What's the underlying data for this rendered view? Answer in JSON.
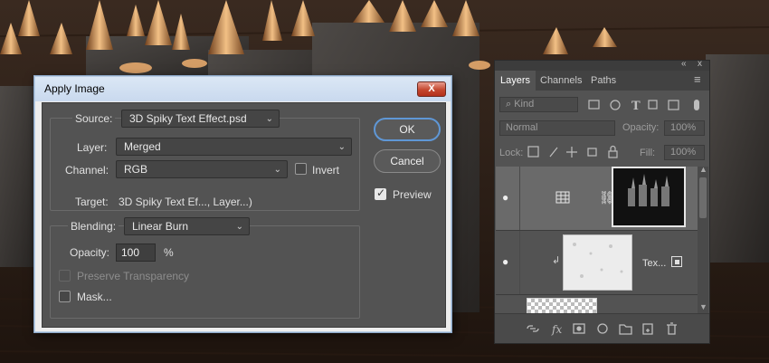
{
  "dialog": {
    "title": "Apply Image",
    "close_label": "X",
    "source_label": "Source:",
    "source_value": "3D Spiky Text Effect.psd",
    "layer_label": "Layer:",
    "layer_value": "Merged",
    "channel_label": "Channel:",
    "channel_value": "RGB",
    "invert_label": "Invert",
    "invert_checked": false,
    "target_label": "Target:",
    "target_value": "3D Spiky Text Ef..., Layer...)",
    "blending_label": "Blending:",
    "blending_value": "Linear Burn",
    "opacity_label": "Opacity:",
    "opacity_value": "100",
    "opacity_unit": "%",
    "preserve_label": "Preserve Transparency",
    "mask_label": "Mask...",
    "ok_label": "OK",
    "cancel_label": "Cancel",
    "preview_label": "Preview",
    "preview_checked": true
  },
  "panel": {
    "collapse_glyph": "«",
    "close_glyph": "x",
    "tabs": [
      "Layers",
      "Channels",
      "Paths"
    ],
    "menu_glyph": "≡",
    "filter_value": "Kind",
    "blend_mode": "Normal",
    "opacity_label": "Opacity:",
    "opacity_value": "100%",
    "lock_label": "Lock:",
    "fill_label": "Fill:",
    "fill_value": "100%",
    "layers": [
      {
        "name": "",
        "visible": true,
        "selected": true
      },
      {
        "name": "Tex...",
        "visible": true,
        "selected": false
      }
    ]
  },
  "colors": {
    "dialog_bg": "#535353",
    "accent_blue": "#5f97d6",
    "titlebar": "#c9d9ee",
    "close_red": "#c4472f"
  }
}
